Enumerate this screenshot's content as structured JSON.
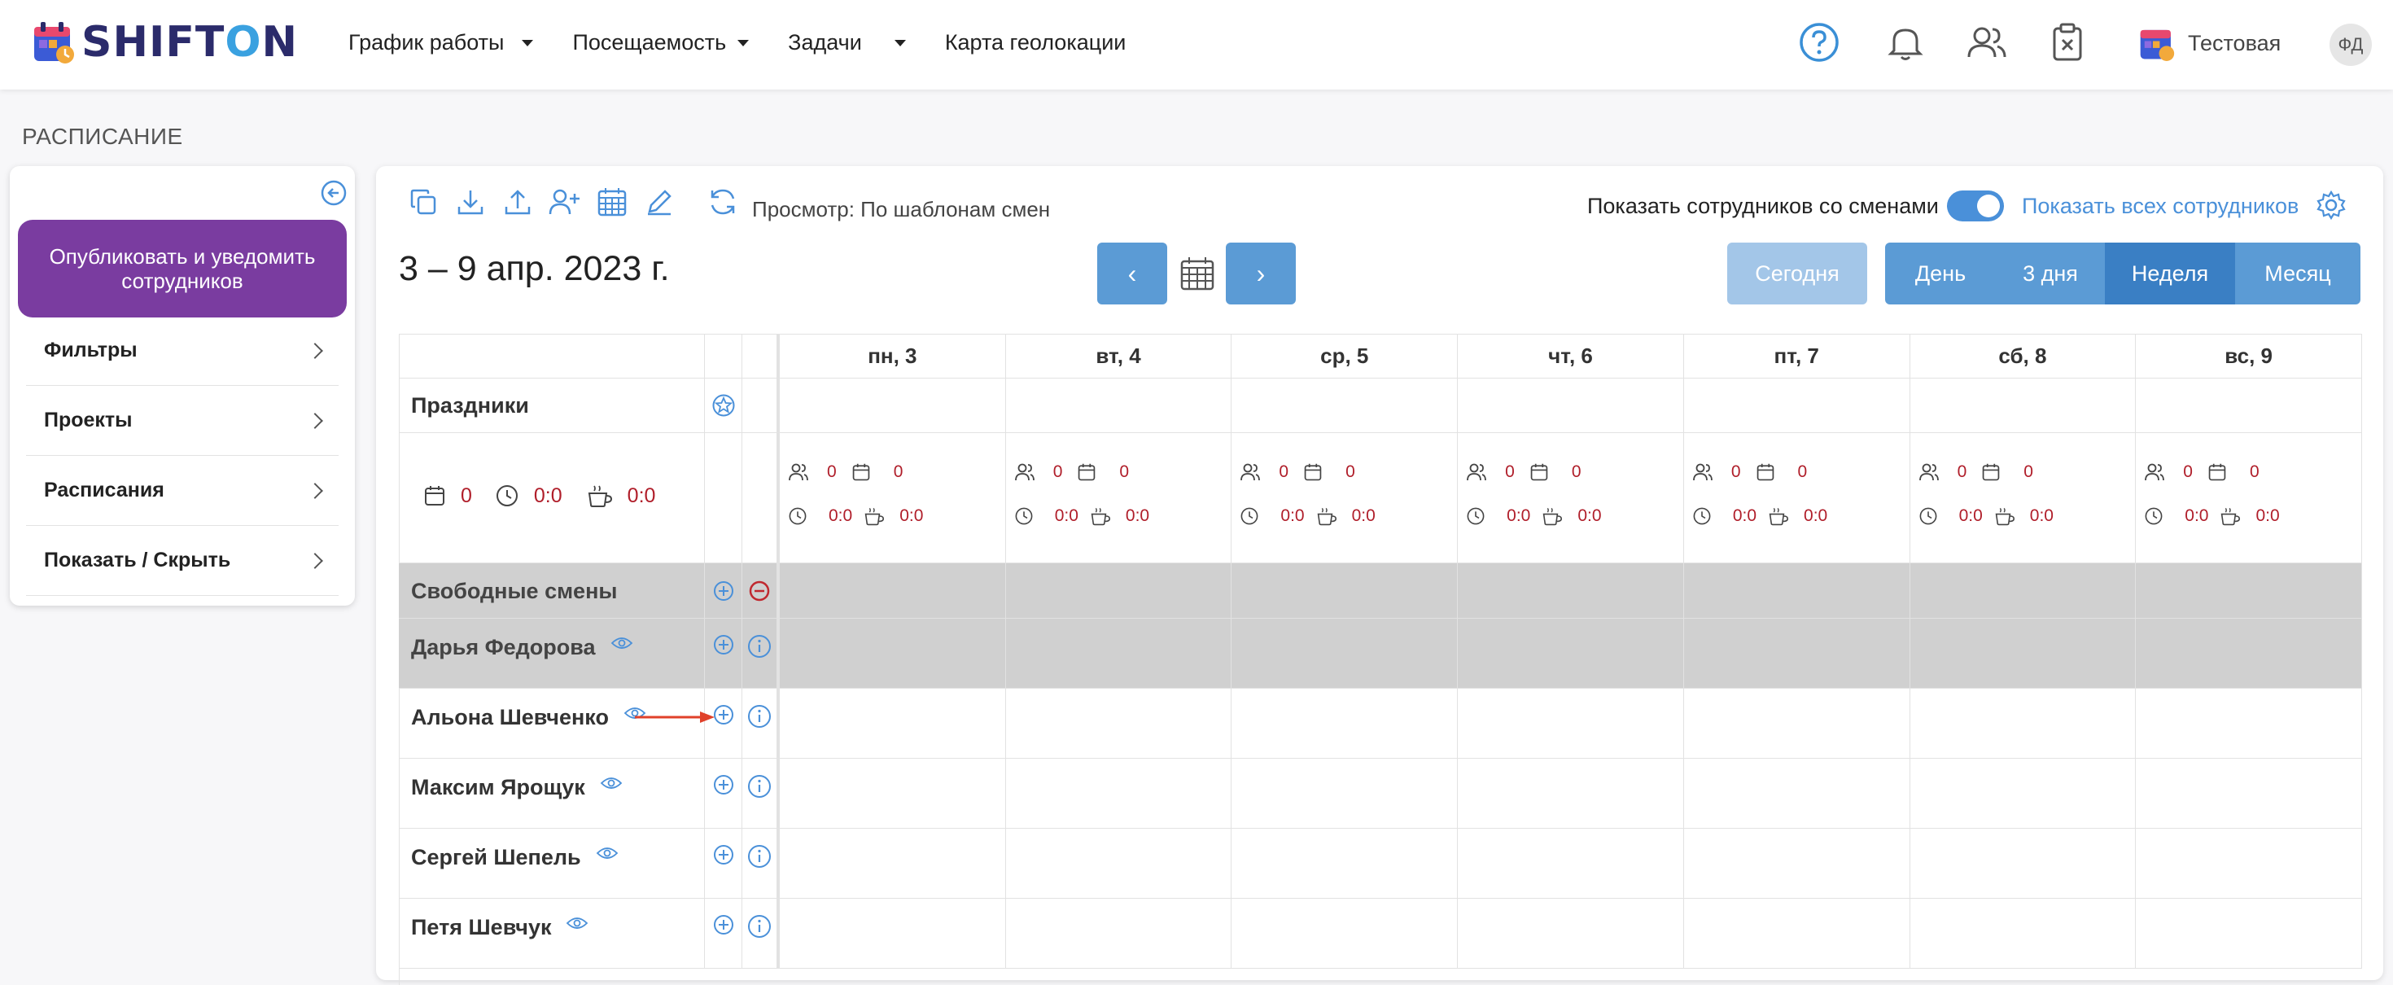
{
  "app": {
    "logo_text": "SHIFTON",
    "nav": [
      {
        "label": "График работы",
        "dropdown": true
      },
      {
        "label": "Посещаемость",
        "dropdown": true
      },
      {
        "label": "Задачи",
        "dropdown": true
      },
      {
        "label": "Карта геолокации",
        "dropdown": false
      }
    ],
    "company": "Тестовая",
    "avatar_initials": "ФД"
  },
  "page_title": "РАСПИСАНИЕ",
  "sidebar": {
    "publish_label": "Опубликовать и уведомить сотрудников",
    "items": [
      {
        "label": "Фильтры"
      },
      {
        "label": "Проекты"
      },
      {
        "label": "Расписания"
      },
      {
        "label": "Показать / Скрыть"
      }
    ]
  },
  "toolbar": {
    "view_label": "Просмотр: По шаблонам смен",
    "show_with_shifts_label": "Показать сотрудников со сменами",
    "show_with_shifts_on": true,
    "show_all_label": "Показать всех сотрудников"
  },
  "schedule": {
    "date_range": "3 – 9 апр. 2023 г.",
    "prev_label": "‹",
    "next_label": "›",
    "today_label": "Сегодня",
    "ranges": [
      {
        "label": "День",
        "active": false
      },
      {
        "label": "3 дня",
        "active": false
      },
      {
        "label": "Неделя",
        "active": true
      },
      {
        "label": "Месяц",
        "active": false
      }
    ],
    "days": [
      "пн, 3",
      "вт, 4",
      "ср, 5",
      "чт, 6",
      "пт, 7",
      "сб, 8",
      "вс, 9"
    ],
    "holidays_label": "Праздники",
    "summary": {
      "shifts": "0",
      "hours": "0:0",
      "breaks": "0:0"
    },
    "day_stats": [
      {
        "people": "0",
        "shifts": "0",
        "hours": "0:0",
        "breaks": "0:0"
      },
      {
        "people": "0",
        "shifts": "0",
        "hours": "0:0",
        "breaks": "0:0"
      },
      {
        "people": "0",
        "shifts": "0",
        "hours": "0:0",
        "breaks": "0:0"
      },
      {
        "people": "0",
        "shifts": "0",
        "hours": "0:0",
        "breaks": "0:0"
      },
      {
        "people": "0",
        "shifts": "0",
        "hours": "0:0",
        "breaks": "0:0"
      },
      {
        "people": "0",
        "shifts": "0",
        "hours": "0:0",
        "breaks": "0:0"
      },
      {
        "people": "0",
        "shifts": "0",
        "hours": "0:0",
        "breaks": "0:0"
      }
    ],
    "free_shifts_label": "Свободные смены",
    "employees": [
      {
        "name": "Дарья Федорова",
        "highlighted": true
      },
      {
        "name": "Альона Шевченко",
        "highlighted": false,
        "arrow": true
      },
      {
        "name": "Максим Ярощук",
        "highlighted": false
      },
      {
        "name": "Сергей Шепель",
        "highlighted": false
      },
      {
        "name": "Петя Шевчук",
        "highlighted": false
      }
    ]
  },
  "colors": {
    "accent": "#4a90d9",
    "button_blue": "#5b9bd5",
    "button_active": "#3a7fc4",
    "publish_purple": "#7a3ca0",
    "red_value": "#b01e2a",
    "arrow_red": "#e0412a"
  }
}
